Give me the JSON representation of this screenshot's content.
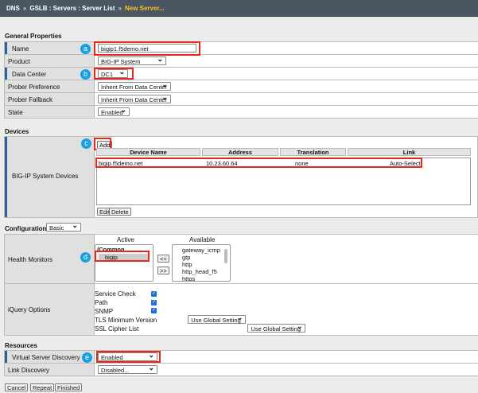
{
  "breadcrumb": {
    "items": [
      "DNS",
      "GSLB : Servers : Server List"
    ],
    "current": "New Server...",
    "separator": "»"
  },
  "general": {
    "heading": "General Properties",
    "name_label": "Name",
    "name_value": "bigip1.f5demo.net",
    "product_label": "Product",
    "product_value": "BIG-IP System",
    "dc_label": "Data Center",
    "dc_value": "DC1",
    "prober_pref_label": "Prober Preference",
    "prober_pref_value": "Inherit From Data Center",
    "prober_fallback_label": "Prober Fallback",
    "prober_fallback_value": "Inherit From Data Center",
    "state_label": "State",
    "state_value": "Enabled"
  },
  "devices": {
    "heading": "Devices",
    "label": "BIG-IP System Devices",
    "add": "Add",
    "edit": "Edit",
    "delete": "Delete",
    "columns": [
      "Device Name",
      "Address",
      "Translation",
      "Link"
    ],
    "rows": [
      [
        "bigip.f5demo.net",
        "10.23.60.64",
        "none",
        "Auto-Select"
      ]
    ]
  },
  "config": {
    "label": "Configuration:",
    "value": "Basic",
    "hm_label": "Health Monitors",
    "active_label": "Active",
    "available_label": "Available",
    "active_group": "/Common",
    "active_items": [
      "bigip"
    ],
    "available_items": [
      "gateway_icmp",
      "gtp",
      "http",
      "http_head_f5",
      "https"
    ],
    "move_left": "<<",
    "move_right": ">>",
    "iquery_label": "iQuery Options",
    "service_check": "Service Check",
    "path": "Path",
    "snmp": "SNMP",
    "service_check_checked": true,
    "path_checked": true,
    "snmp_checked": true,
    "tls_label": "TLS Minimum Version",
    "tls_value": "Use Global Setting",
    "cipher_label": "SSL Cipher List",
    "cipher_value": "Use Global Setting"
  },
  "resources": {
    "heading": "Resources",
    "vsd_label": "Virtual Server Discovery",
    "vsd_value": "Enabled",
    "ld_label": "Link Discovery",
    "ld_value": "Disabled..."
  },
  "buttons": {
    "cancel": "Cancel",
    "repeat": "Repeat",
    "finished": "Finished"
  },
  "callouts": [
    "a",
    "b",
    "c",
    "d",
    "e"
  ],
  "colors": {
    "highlight": "#e8271c",
    "badge": "#1aa0e0",
    "header": "#4b5663",
    "breadcrumb_current": "#f5c518"
  }
}
